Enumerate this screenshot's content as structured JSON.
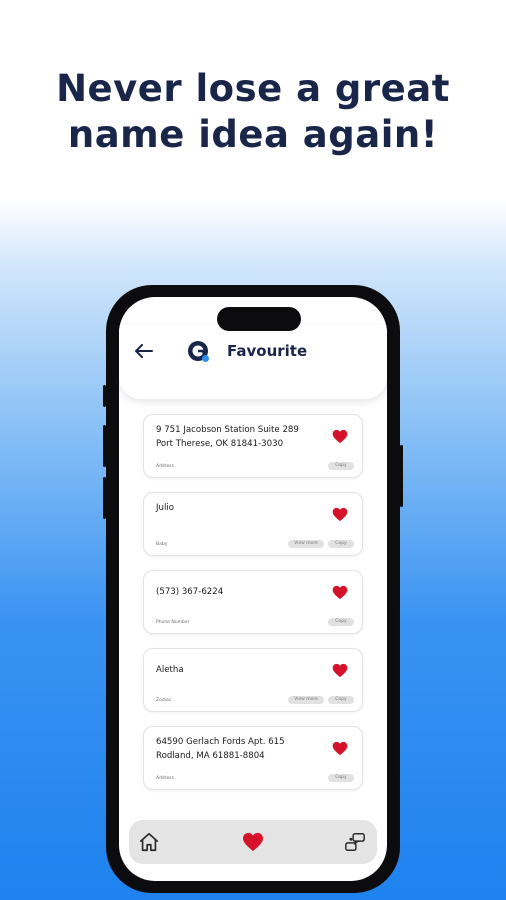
{
  "headline": {
    "line1": "Never lose a great",
    "line2": "name idea again!"
  },
  "header": {
    "title": "Favourite",
    "back_icon": "arrow-left-icon",
    "logo_icon": "app-logo-icon"
  },
  "cards": [
    {
      "value_line1": "9 751 Jacobson Station Suite 289",
      "value_line2": "Port Therese, OK 81841-3030",
      "label": "Address",
      "buttons": [
        "Copy"
      ]
    },
    {
      "value_line1": "Julio",
      "value_line2": "",
      "label": "Baby",
      "buttons": [
        "View more",
        "Copy"
      ]
    },
    {
      "value_line1": "(573) 367-6224",
      "value_line2": "",
      "label": "Phone Number",
      "buttons": [
        "Copy"
      ]
    },
    {
      "value_line1": "Aletha",
      "value_line2": "",
      "label": "Zodiac",
      "buttons": [
        "View more",
        "Copy"
      ]
    },
    {
      "value_line1": "64590 Gerlach Fords Apt. 615",
      "value_line2": "Rodland, MA 61881-8804",
      "label": "Address",
      "buttons": [
        "Copy"
      ]
    }
  ],
  "nav": {
    "items": [
      "home-icon",
      "heart-icon",
      "chat-icon"
    ],
    "active": "heart-icon"
  },
  "colors": {
    "heart": "#d6122a",
    "title": "#19264a",
    "bg_blue": "#1e82ef"
  }
}
